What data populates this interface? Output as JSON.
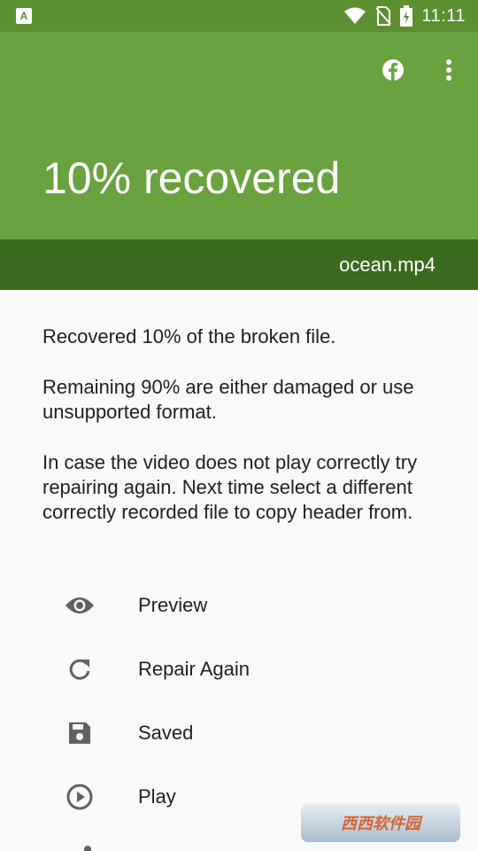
{
  "status_bar": {
    "left_icon": "A",
    "time": "11:11",
    "icons": [
      "wifi-icon",
      "no-sim-icon",
      "battery-charging-icon"
    ]
  },
  "app_bar": {
    "headline": "10% recovered",
    "filename": "ocean.mp4",
    "colors": {
      "primary": "#69a23f",
      "dark": "#3b6a1f",
      "status": "#5b8f2f"
    }
  },
  "content": {
    "p1": "Recovered 10% of the broken file.",
    "p2": "Remaining 90% are either damaged or use unsupported format.",
    "p3": "In case the video does not play correctly try repairing again. Next time select a different correctly recorded file to copy header from."
  },
  "actions": [
    {
      "label": "Preview",
      "icon": "eye-icon"
    },
    {
      "label": "Repair Again",
      "icon": "refresh-icon"
    },
    {
      "label": "Saved",
      "icon": "save-icon"
    },
    {
      "label": "Play",
      "icon": "play-icon"
    }
  ],
  "watermark": {
    "text": "西西软件园"
  }
}
